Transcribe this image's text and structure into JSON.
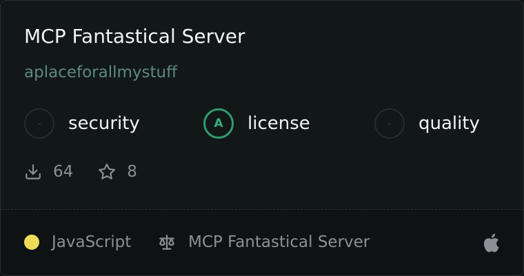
{
  "card": {
    "title": "MCP Fantastical Server",
    "author": "aplaceforallmystuff"
  },
  "scores": [
    {
      "grade": "-",
      "label": "security",
      "status": "none"
    },
    {
      "grade": "A",
      "label": "license",
      "status": "good"
    },
    {
      "grade": "-",
      "label": "quality",
      "status": "none"
    }
  ],
  "stats": {
    "downloads": "64",
    "downloads_icon": "download-icon",
    "stars": "8",
    "stars_icon": "star-icon"
  },
  "footer": {
    "language": "JavaScript",
    "language_color": "#f0dc5a",
    "license_icon": "scale-icon",
    "license_name": "MCP Fantastical Server",
    "platform_icon": "apple-icon"
  },
  "colors": {
    "accent_green": "#2f9e6e",
    "author": "#5c8a7c",
    "background": "#121718"
  }
}
